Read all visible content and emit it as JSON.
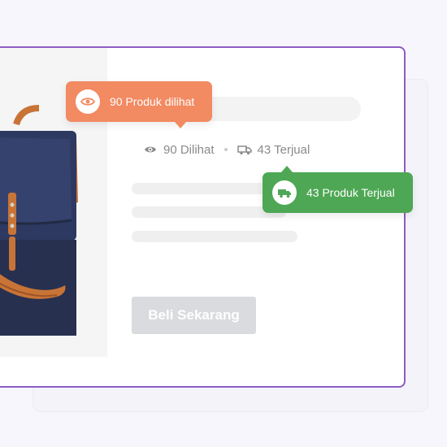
{
  "product": {
    "image_alt": "blue canvas messenger bag with brown leather straps",
    "views_label": "90 Dilihat",
    "sold_label": "43 Terjual",
    "buy_button": "Beli Sekarang"
  },
  "tooltips": {
    "views": {
      "text": "90 Produk dilihat",
      "icon": "eye-icon",
      "color": "#f28a62"
    },
    "sold": {
      "text": "43 Produk Terjual",
      "icon": "truck-icon",
      "color": "#4ea754"
    }
  },
  "colors": {
    "card_border": "#8e5cc2",
    "button_bg": "#d9dbde",
    "background": "#f7f6fc"
  }
}
